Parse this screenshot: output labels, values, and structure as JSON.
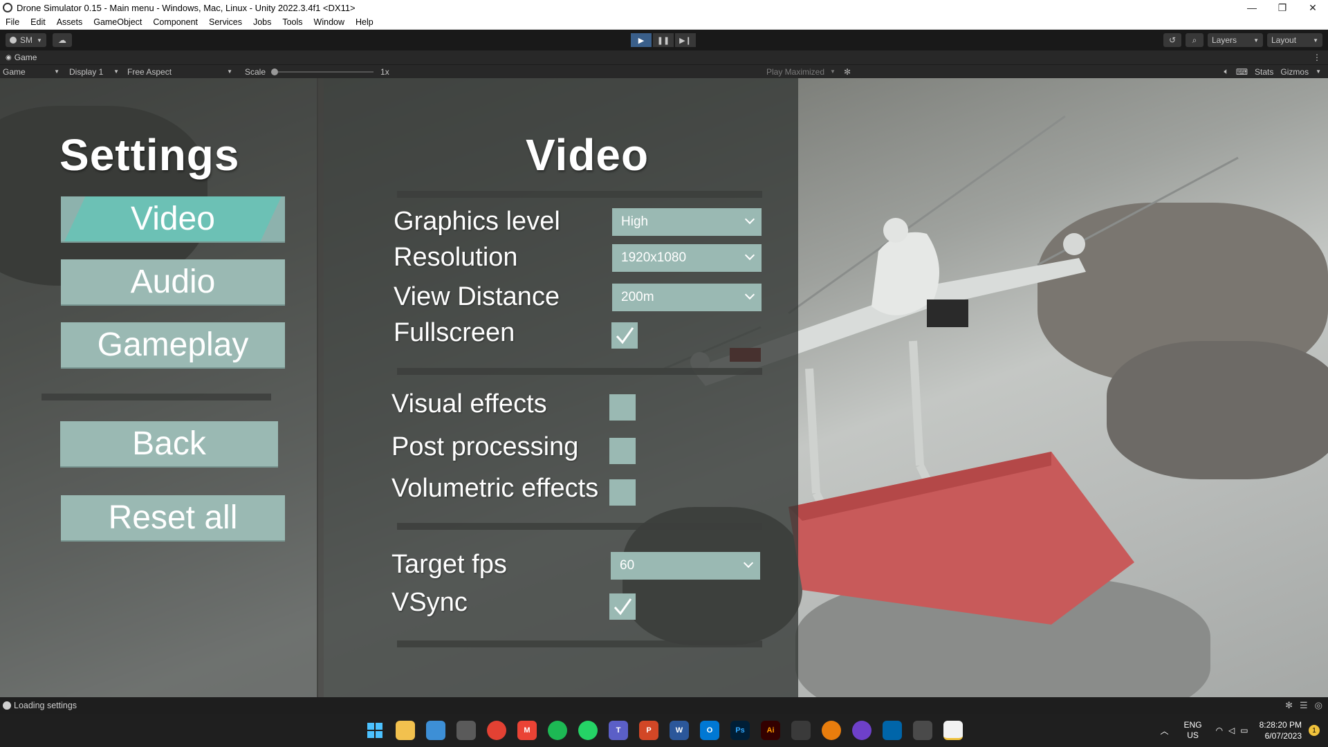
{
  "window": {
    "title": "Drone Simulator 0.15 - Main menu - Windows, Mac, Linux - Unity 2022.3.4f1 <DX11>",
    "controls": [
      "—",
      "❐",
      "✕"
    ]
  },
  "menubar": [
    "File",
    "Edit",
    "Assets",
    "GameObject",
    "Component",
    "Services",
    "Jobs",
    "Tools",
    "Window",
    "Help"
  ],
  "toolbar": {
    "account": "SM",
    "layers": "Layers",
    "layout": "Layout"
  },
  "game_tab": {
    "tab_label": "Game",
    "view_mode": "Game",
    "display": "Display 1",
    "aspect": "Free Aspect",
    "scale_label": "Scale",
    "scale_value": "1x",
    "play_mode": "Play Maximized",
    "stats": "Stats",
    "gizmos": "Gizmos"
  },
  "settings_menu": {
    "title": "Settings",
    "buttons": [
      "Video",
      "Audio",
      "Gameplay",
      "Back",
      "Reset all"
    ],
    "selected": "Video"
  },
  "video_panel": {
    "title": "Video",
    "graphics_level": {
      "label": "Graphics level",
      "value": "High"
    },
    "resolution": {
      "label": "Resolution",
      "value": "1920x1080"
    },
    "view_distance": {
      "label": "View Distance",
      "value": "200m"
    },
    "fullscreen": {
      "label": "Fullscreen",
      "checked": true
    },
    "visual_effects": {
      "label": "Visual effects",
      "checked": false
    },
    "post_processing": {
      "label": "Post processing",
      "checked": false
    },
    "volumetric_effects": {
      "label": "Volumetric effects",
      "checked": false
    },
    "target_fps": {
      "label": "Target fps",
      "value": "60"
    },
    "vsync": {
      "label": "VSync",
      "checked": true
    }
  },
  "statusbar": {
    "message": "Loading settings"
  },
  "taskbar": {
    "lang": "ENG",
    "region": "US",
    "time": "8:28:20 PM",
    "date": "6/07/2023",
    "notification_count": "1"
  },
  "colors": {
    "button_fill": "#9ab9b3",
    "selected_fill": "#6cc1b5",
    "panel": "#34383 6"
  }
}
